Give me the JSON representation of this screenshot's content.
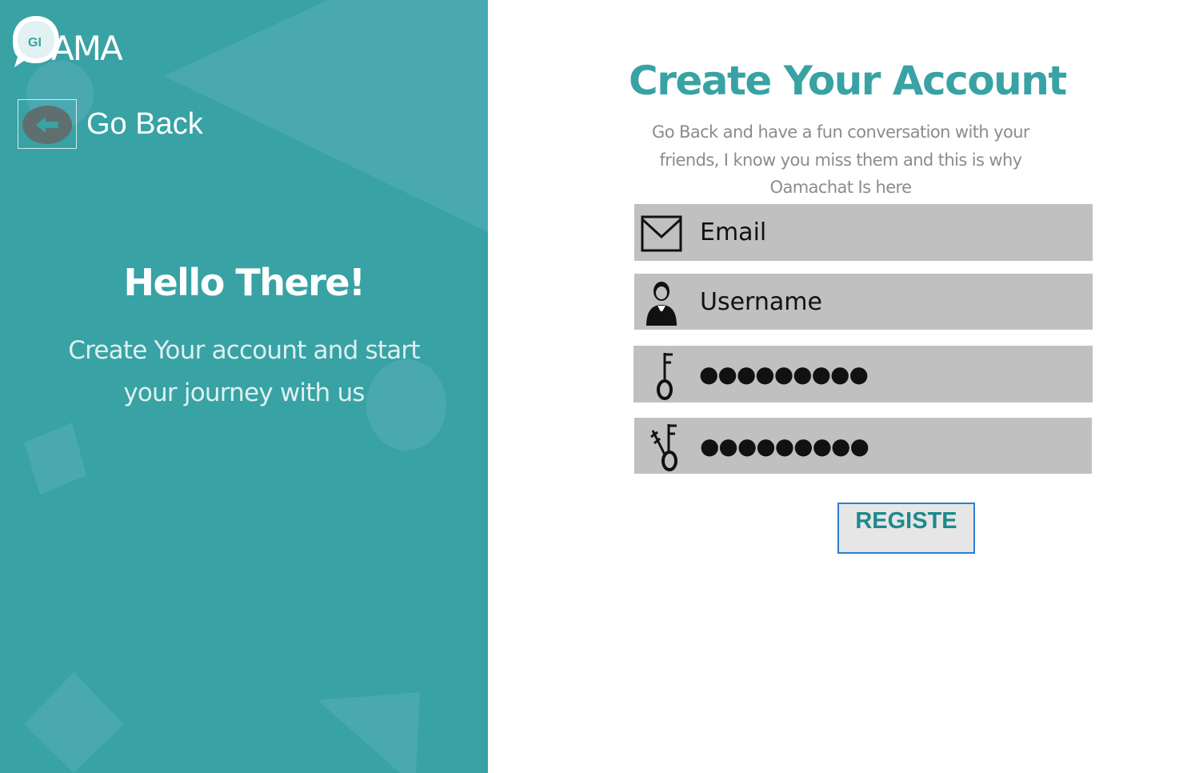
{
  "brand": {
    "bubble_text": "GI",
    "name": "AMA"
  },
  "nav": {
    "go_back_label": "Go Back"
  },
  "left": {
    "heading": "Hello There!",
    "subtitle_line1": "Create Your account and start",
    "subtitle_line2": "your journey with us"
  },
  "form": {
    "title": "Create Your Account",
    "description_line1": "Go Back and have a fun conversation with your",
    "description_line2": "friends, I know you miss them  and this is why",
    "description_line3": "Oamachat Is here",
    "email_placeholder": "Email",
    "username_placeholder": "Username",
    "password_value": "●●●●●●●●●",
    "confirm_password_value": "●●●●●●●●●",
    "register_label": "REGISTE"
  },
  "icons": {
    "back": "arrow-left-icon",
    "email": "envelope-icon",
    "username": "user-icon",
    "password": "key-icon",
    "confirm_password": "keys-icon"
  },
  "colors": {
    "accent": "#38a2a4",
    "panel_shape": "#4aa9b0",
    "input_bg": "#c0c0c0",
    "button_border": "#2b7fd4",
    "button_text": "#1d8a8c"
  }
}
